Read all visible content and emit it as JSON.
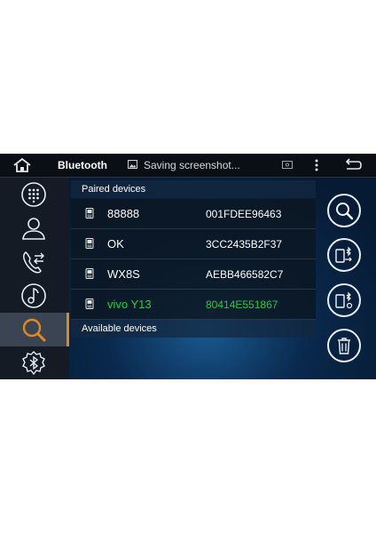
{
  "header": {
    "title": "Bluetooth",
    "notification": "Saving screenshot..."
  },
  "icons": {
    "home": "home-icon",
    "screenshot": "image-icon",
    "cast": "cast-icon",
    "menu": "overflow-menu-icon",
    "back": "back-icon"
  },
  "sidebar": {
    "items": [
      {
        "name": "dialpad",
        "icon": "dialpad-icon",
        "active": false
      },
      {
        "name": "contacts",
        "icon": "contact-icon",
        "active": false
      },
      {
        "name": "call-log",
        "icon": "call-transfer-icon",
        "active": false
      },
      {
        "name": "music",
        "icon": "music-icon",
        "active": false
      },
      {
        "name": "search",
        "icon": "search-icon",
        "active": true
      },
      {
        "name": "bluetooth-settings",
        "icon": "bluetooth-settings-icon",
        "active": false
      }
    ],
    "active_color": "#e08a1e"
  },
  "paired_section": "Paired devices",
  "available_section": "Available devices",
  "devices": [
    {
      "name": "88888",
      "address": "001FDEE96463",
      "connected": false
    },
    {
      "name": "OK",
      "address": "3CC2435B2F37",
      "connected": false
    },
    {
      "name": "WX8S",
      "address": "AEBB466582C7",
      "connected": false
    },
    {
      "name": "vivo Y13",
      "address": "80414E551867",
      "connected": true
    }
  ],
  "connected_color": "#19d23a",
  "actions": [
    {
      "name": "search",
      "icon": "search-icon"
    },
    {
      "name": "connect",
      "icon": "phone-bluetooth-connect-icon"
    },
    {
      "name": "disconnect",
      "icon": "phone-bluetooth-disconnect-icon"
    },
    {
      "name": "delete",
      "icon": "trash-icon"
    }
  ]
}
